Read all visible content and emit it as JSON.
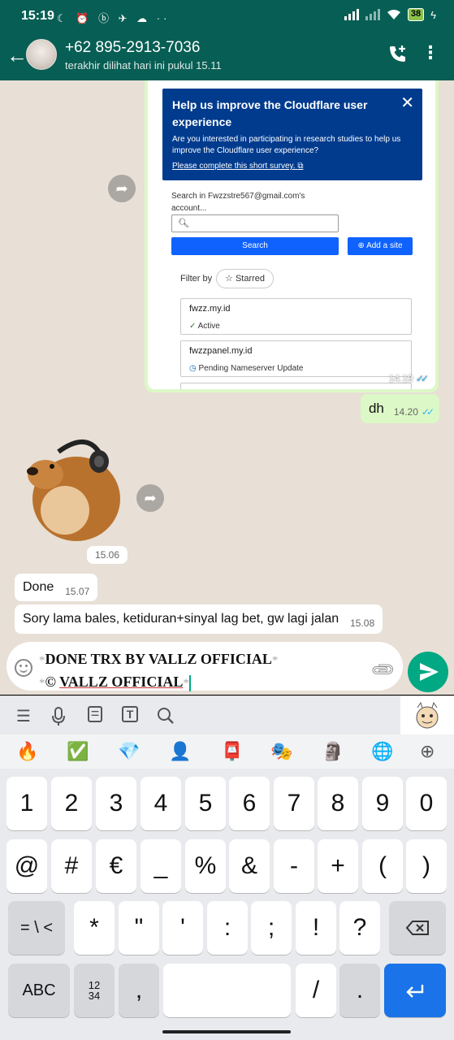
{
  "status_bar": {
    "time": "15:19",
    "left_icons": "☾ ⏰ ⓑ ✈ ☁ ··",
    "battery": "38"
  },
  "header": {
    "contact_name": "+62 895-2913-7036",
    "last_seen": "terakhir dilihat hari ini pukul 15.11"
  },
  "screenshot_message": {
    "banner_title": "Help us improve the Cloudflare user experience",
    "banner_text": "Are you interested in participating in research studies to help us improve the Cloudflare user experience?",
    "banner_link": "Please complete this short survey.",
    "search_label": "Search in Fwzzstre567@gmail.com's account...",
    "search_button": "Search",
    "add_site_button": "Add a site",
    "filter_label": "Filter by",
    "starred_chip": "Starred",
    "sites": [
      {
        "domain": "fwzz.my.id",
        "state": "Active"
      },
      {
        "domain": "fwzzpanel.my.id",
        "state": "Pending Nameserver Update"
      }
    ],
    "time": "14.19"
  },
  "messages": [
    {
      "direction": "out",
      "text": "dh",
      "time": "14.20"
    },
    {
      "direction": "in",
      "type": "sticker",
      "time": "15.06"
    },
    {
      "direction": "in",
      "text": "Done",
      "time": "15.07"
    },
    {
      "direction": "in",
      "text": "Sory lama bales, ketiduran+sinyal lag bet, gw lagi jalan",
      "time": "15.08"
    }
  ],
  "composer": {
    "line1": "DONE TRX BY VALLZ OFFICIAL",
    "line2_prefix": "© ",
    "line2": "VALLZ OFFICIAL"
  },
  "keyboard": {
    "emoji_row": [
      "🔥",
      "✅",
      "💎",
      "👤",
      "📮",
      "🎭",
      "🗿",
      "🌐",
      "⊕"
    ],
    "row1": [
      "1",
      "2",
      "3",
      "4",
      "5",
      "6",
      "7",
      "8",
      "9",
      "0"
    ],
    "row2": [
      "@",
      "#",
      "€",
      "_",
      "%",
      "&",
      "-",
      "+",
      "(",
      ")"
    ],
    "row3": [
      "= \\ <",
      "*",
      "\"",
      "'",
      ":",
      ";",
      "!",
      "?"
    ],
    "abc_label": "ABC",
    "fraction_label": "12\n34",
    "comma": ",",
    "slash": "/",
    "period": "."
  },
  "colors": {
    "header": "#075E54",
    "outgoing_bubble": "#dcf8c6",
    "send_button": "#00a884",
    "cloudflare_banner": "#003b8e",
    "cloudflare_button": "#0f62fe"
  }
}
